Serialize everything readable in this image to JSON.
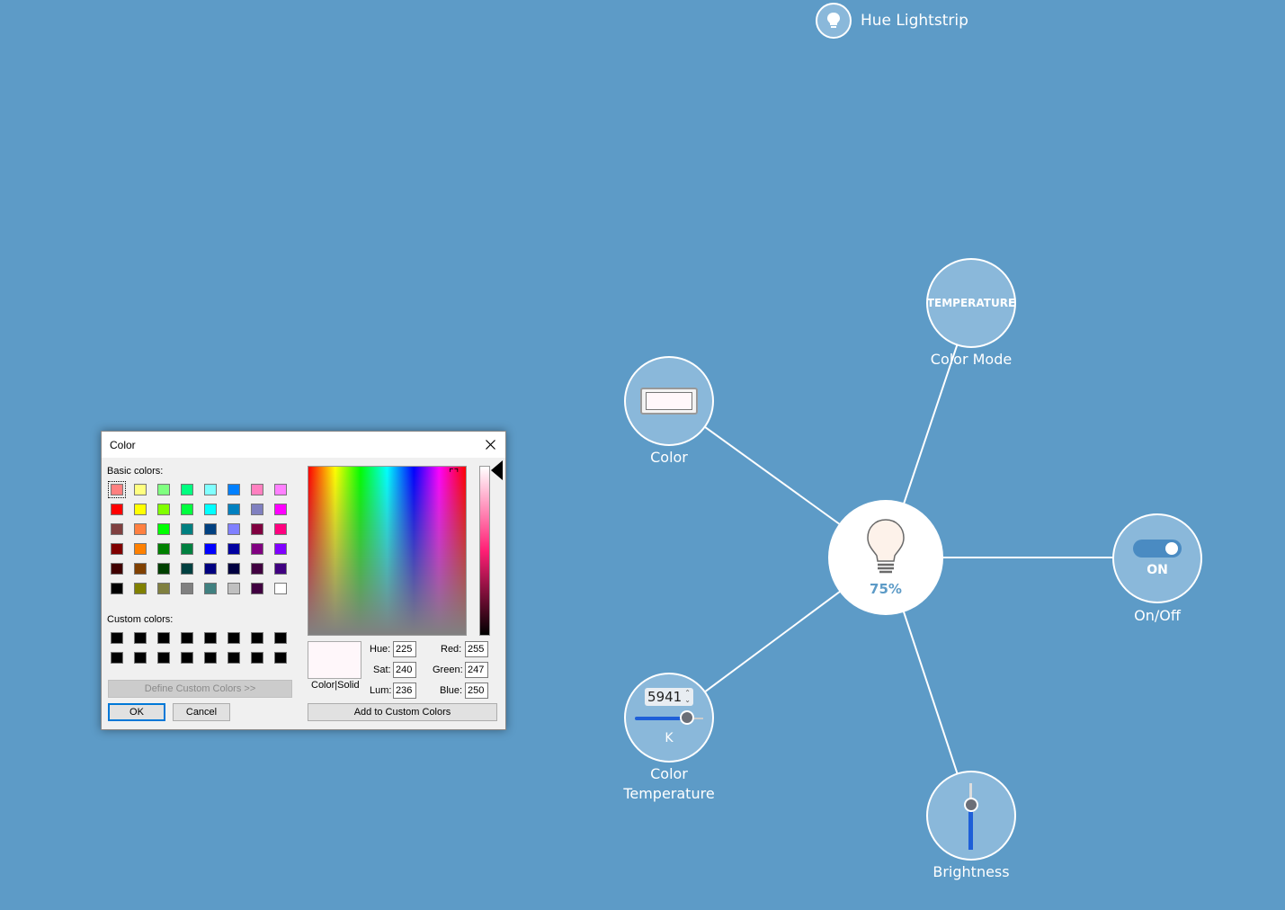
{
  "device": {
    "name": "Hue Lightstrip",
    "icon": "bulb-icon"
  },
  "hub": {
    "brightness_label": "75%",
    "brightness_percent": 75,
    "nodes": {
      "color_mode": {
        "value": "TEMPERATURE",
        "label": "Color Mode"
      },
      "color": {
        "label": "Color",
        "swatch": "#fff7fa"
      },
      "onoff": {
        "value": "ON",
        "label": "On/Off"
      },
      "color_temperature": {
        "value": "5941",
        "unit": "K",
        "label_line1": "Color",
        "label_line2": "Temperature"
      },
      "brightness": {
        "label": "Brightness"
      }
    }
  },
  "color_dialog": {
    "title": "Color",
    "basic_colors_label": "Basic colors:",
    "custom_colors_label": "Custom colors:",
    "basic_colors": [
      "#ff8080",
      "#ffff80",
      "#80ff80",
      "#00ff80",
      "#80ffff",
      "#0080ff",
      "#ff80c0",
      "#ff80ff",
      "#ff0000",
      "#ffff00",
      "#80ff00",
      "#00ff40",
      "#00ffff",
      "#0080c0",
      "#8080c0",
      "#ff00ff",
      "#804040",
      "#ff8040",
      "#00ff00",
      "#008080",
      "#004080",
      "#8080ff",
      "#800040",
      "#ff0080",
      "#800000",
      "#ff8000",
      "#008000",
      "#008040",
      "#0000ff",
      "#0000a0",
      "#800080",
      "#8000ff",
      "#400000",
      "#804000",
      "#004000",
      "#004040",
      "#000080",
      "#000040",
      "#400040",
      "#400080",
      "#000000",
      "#808000",
      "#808040",
      "#808080",
      "#408080",
      "#c0c0c0",
      "#400040",
      "#ffffff"
    ],
    "custom_colors": [
      "#000000",
      "#000000",
      "#000000",
      "#000000",
      "#000000",
      "#000000",
      "#000000",
      "#000000",
      "#000000",
      "#000000",
      "#000000",
      "#000000",
      "#000000",
      "#000000",
      "#000000",
      "#000000"
    ],
    "define_custom_label": "Define Custom Colors >>",
    "ok_label": "OK",
    "cancel_label": "Cancel",
    "color_solid_label": "Color|Solid",
    "hue_label": "Hue:",
    "hue": "225",
    "sat_label": "Sat:",
    "sat": "240",
    "lum_label": "Lum:",
    "lum": "236",
    "red_label": "Red:",
    "red": "255",
    "green_label": "Green:",
    "green": "247",
    "blue_label": "Blue:",
    "blue": "250",
    "add_custom_label": "Add to Custom Colors"
  }
}
